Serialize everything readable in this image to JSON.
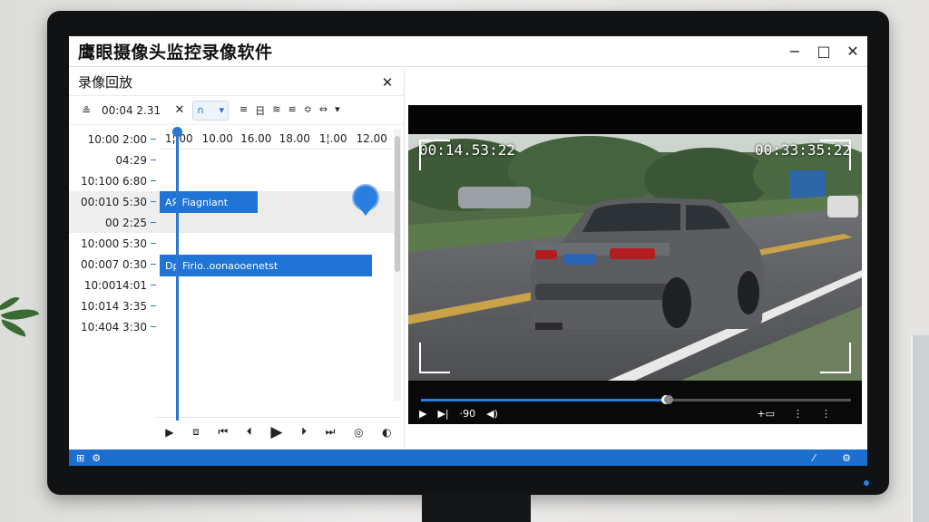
{
  "app": {
    "title": "鹰眼摄像头监控录像软件",
    "window_controls": [
      "−",
      "□",
      "✕"
    ]
  },
  "panel": {
    "title": "录像回放",
    "close": "✕"
  },
  "toolbar": {
    "icon": "≗",
    "time": "00:04 2.31",
    "clear": "✕",
    "dropdown_value": "∩",
    "tools": [
      "≡",
      "日",
      "≋",
      "≌",
      "≎",
      "⇔"
    ]
  },
  "timeline": {
    "ruler": [
      "1¦.00",
      "10.00",
      "16.00",
      "18.00",
      "1¦.00",
      "12.00"
    ],
    "times": [
      "10:00 2:00",
      "04:29",
      "10:100 6:80",
      "00:010 5:30",
      "00 2:25",
      "10:000 5:30",
      "00:007 0:30",
      "10:0014:01",
      "10:014 3:35",
      "10:404 3:30"
    ],
    "clips": [
      "AЯ Fiagniant",
      "Dp Firio..oonaooenetst"
    ]
  },
  "playback_controls": [
    "▶",
    "⧈",
    "⏮",
    "⏴",
    "▶",
    "⏵",
    "⏭",
    "◎",
    "◐"
  ],
  "video": {
    "osd_left": "00:14.53:22",
    "osd_right": "00:33:35:22",
    "progress": 0.57,
    "time_label": "·90",
    "controls": [
      "▶",
      "▶|",
      "·90",
      "◀)"
    ],
    "right_controls": [
      "+▭",
      "⋮",
      "⋮"
    ]
  },
  "taskbar": {
    "start": "⊞",
    "item": "⚙",
    "right_items": [
      "⁄",
      "⚙"
    ]
  }
}
